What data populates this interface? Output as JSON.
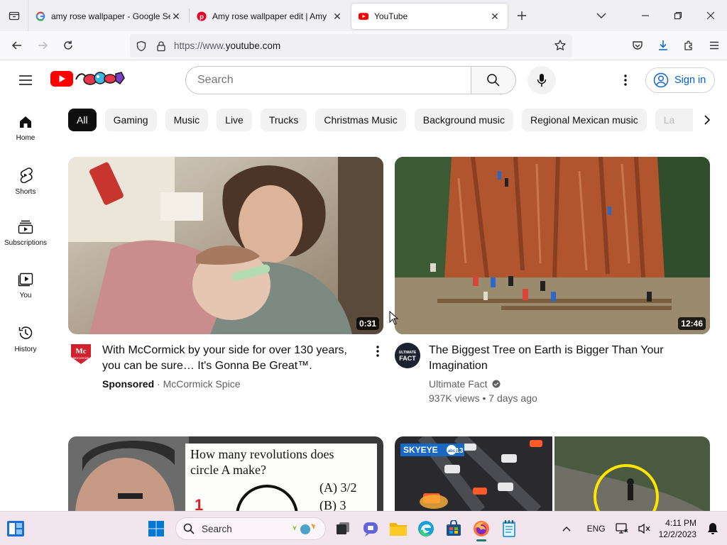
{
  "browser": {
    "tabs": [
      {
        "title": "amy rose wallpaper - Google Se",
        "favicon": "google-g-icon",
        "active": false
      },
      {
        "title": "Amy rose wallpaper edit | Amy",
        "favicon": "pinterest-icon",
        "active": false
      },
      {
        "title": "YouTube",
        "favicon": "youtube-icon",
        "active": true
      }
    ],
    "url_scheme": "https://www.",
    "url_host": "youtube.com"
  },
  "youtube": {
    "search_placeholder": "Search",
    "sign_in_label": "Sign in",
    "sidebar": [
      {
        "label": "Home",
        "icon": "home-icon"
      },
      {
        "label": "Shorts",
        "icon": "shorts-icon"
      },
      {
        "label": "Subscriptions",
        "icon": "subscriptions-icon"
      },
      {
        "label": "You",
        "icon": "you-library-icon"
      },
      {
        "label": "History",
        "icon": "history-icon"
      }
    ],
    "chips": [
      "All",
      "Gaming",
      "Music",
      "Live",
      "Trucks",
      "Christmas Music",
      "Background music",
      "Regional Mexican music",
      "La"
    ],
    "videos": [
      {
        "title": "With McCormick by your side for over 130 years, you can be sure… It's Gonna Be Great™.",
        "sponsored_label": "Sponsored",
        "channel": "McCormick Spice",
        "duration": "0:31",
        "avatar_text": "McCormick"
      },
      {
        "title": "The Biggest Tree on Earth is Bigger Than Your Imagination",
        "channel": "Ultimate Fact",
        "stats": "937K views • 7 days ago",
        "duration": "12:46",
        "avatar_text": "ULTIMATE FACT"
      },
      {
        "thumb_text_line1": "How many revolutions does",
        "thumb_text_line2": "circle A make?",
        "option_a": "(A) 3/2",
        "option_b": "(B) 3"
      },
      {
        "thumb_badge": "SKYEYE"
      }
    ]
  },
  "taskbar": {
    "search_label": "Search",
    "language": "ENG",
    "time": "4:11 PM",
    "date": "12/2/2023"
  },
  "colors": {
    "youtube_red": "#ff0000",
    "link_blue": "#065fd4",
    "chip_bg": "#f2f2f2",
    "taskbar_bg": "#f3e5ee"
  }
}
